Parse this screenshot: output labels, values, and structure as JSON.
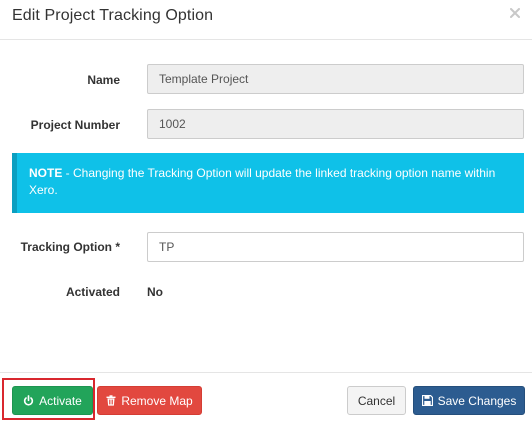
{
  "modal": {
    "title": "Edit Project Tracking Option"
  },
  "form": {
    "name": {
      "label": "Name",
      "value": "Template Project"
    },
    "project_number": {
      "label": "Project Number",
      "value": "1002"
    },
    "note": {
      "strong": "NOTE",
      "text": " - Changing the Tracking Option will update the linked tracking option name within Xero."
    },
    "tracking_option": {
      "label": "Tracking Option *",
      "value": "TP"
    },
    "activated": {
      "label": "Activated",
      "value": "No"
    }
  },
  "footer": {
    "activate_label": "Activate",
    "remove_map_label": "Remove Map",
    "cancel_label": "Cancel",
    "save_label": "Save Changes"
  },
  "icons": {
    "close": "close-icon",
    "activate": "power-icon",
    "remove_map": "trash-icon",
    "save": "floppy-disk-icon"
  },
  "colors": {
    "note_background": "#0fc1e8",
    "activate": "#22a45a",
    "remove_map": "#e2483f",
    "save": "#2c5c90",
    "highlight": "#d9272e"
  }
}
